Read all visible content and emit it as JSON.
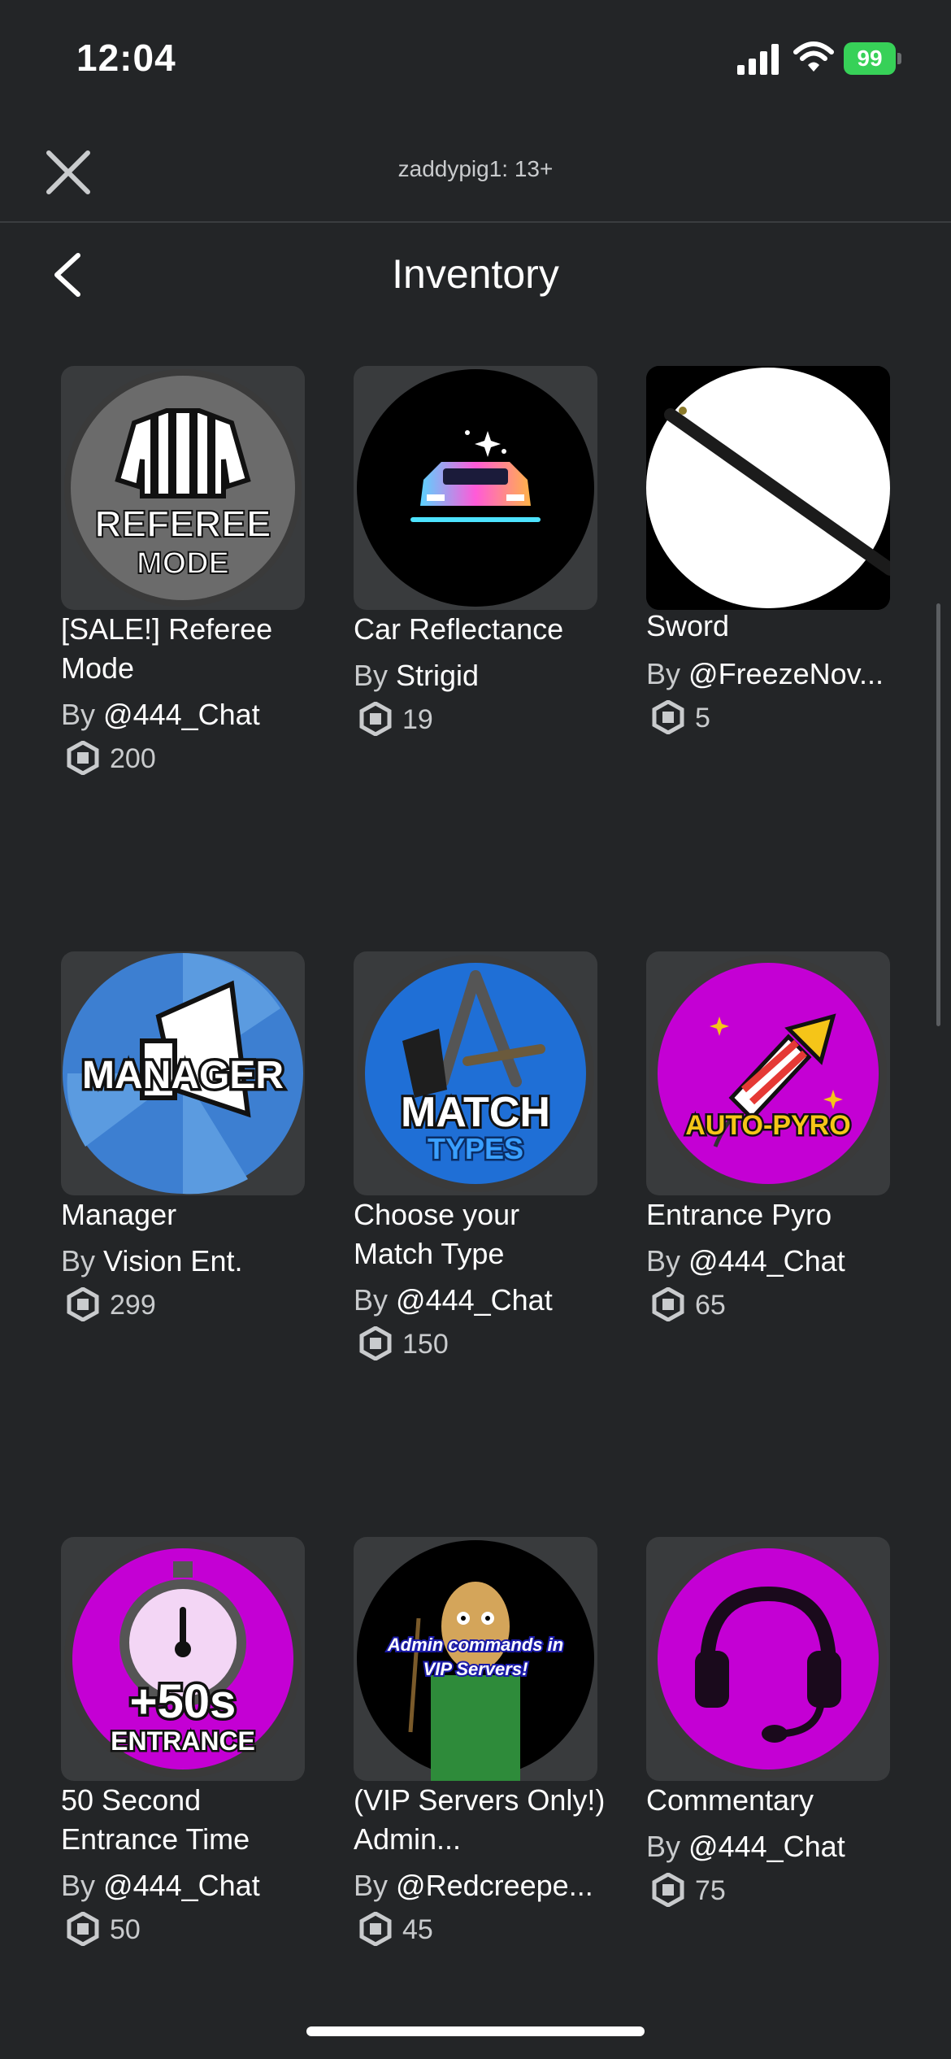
{
  "status": {
    "time": "12:04",
    "battery": "99"
  },
  "topbar": {
    "account_label": "zaddypig1: 13+"
  },
  "header": {
    "title": "Inventory"
  },
  "items": [
    {
      "name": "[SALE!] Referee Mode",
      "by": "By",
      "creator": "@444_Chat",
      "price": "200",
      "icon": "referee-mode-icon",
      "thumb_text": [
        "REFEREE",
        "MODE"
      ]
    },
    {
      "name": "Car Reflectance",
      "by": "By",
      "creator": "Strigid",
      "price": "19",
      "icon": "car-icon"
    },
    {
      "name": "Sword",
      "by": "By",
      "creator": "@FreezeNov...",
      "price": "5",
      "icon": "sword-icon"
    },
    {
      "name": "Manager",
      "by": "By",
      "creator": "Vision Ent.",
      "price": "299",
      "icon": "megaphone-icon",
      "thumb_text": [
        "MANAGER"
      ]
    },
    {
      "name": "Choose your Match Type",
      "by": "By",
      "creator": "@444_Chat",
      "price": "150",
      "icon": "match-types-icon",
      "thumb_text": [
        "MATCH",
        "TYPES"
      ]
    },
    {
      "name": "Entrance Pyro",
      "by": "By",
      "creator": "@444_Chat",
      "price": "65",
      "icon": "firework-icon",
      "thumb_text": [
        "AUTO-PYRO"
      ]
    },
    {
      "name": "50 Second Entrance Time",
      "by": "By",
      "creator": "@444_Chat",
      "price": "50",
      "icon": "stopwatch-icon",
      "thumb_text": [
        "+50s",
        "ENTRANCE"
      ]
    },
    {
      "name": "(VIP Servers Only!) Admin...",
      "by": "By",
      "creator": "@Redcreepe...",
      "price": "45",
      "icon": "admin-character-icon",
      "thumb_text": [
        "Admin commands in",
        "VIP Servers!"
      ]
    },
    {
      "name": "Commentary",
      "by": "By",
      "creator": "@444_Chat",
      "price": "75",
      "icon": "headset-icon"
    }
  ],
  "colors": {
    "background": "#232527",
    "battery": "#37d158",
    "magenta": "#c400d4",
    "blue": "#1f6fd6"
  }
}
